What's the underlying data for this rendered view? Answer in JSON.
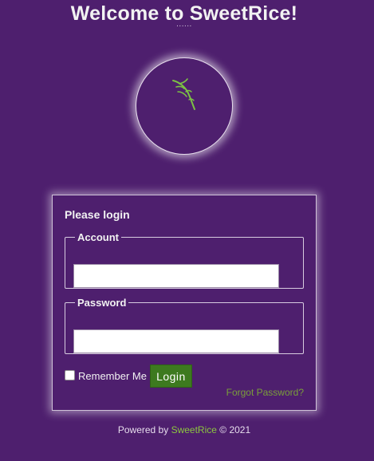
{
  "header": {
    "title": "Welcome to SweetRice!",
    "subtitle": "......"
  },
  "logo": {
    "icon": "leaf-sprig-icon",
    "color": "#7cc144"
  },
  "login_box": {
    "heading": "Please login",
    "account": {
      "legend": "Account",
      "value": "",
      "placeholder": ""
    },
    "password": {
      "legend": "Password",
      "value": "",
      "placeholder": ""
    },
    "remember_me": {
      "label": "Remember Me",
      "checked": false
    },
    "login_button": "Login",
    "forgot_password": "Forgot Password?"
  },
  "footer": {
    "prefix": "Powered by",
    "link": "SweetRice",
    "suffix": "© 2021"
  },
  "colors": {
    "background": "#4e1f6e",
    "button": "#3d7a1f",
    "link": "#8cc63f",
    "forgot_link": "#7a9e3a"
  }
}
